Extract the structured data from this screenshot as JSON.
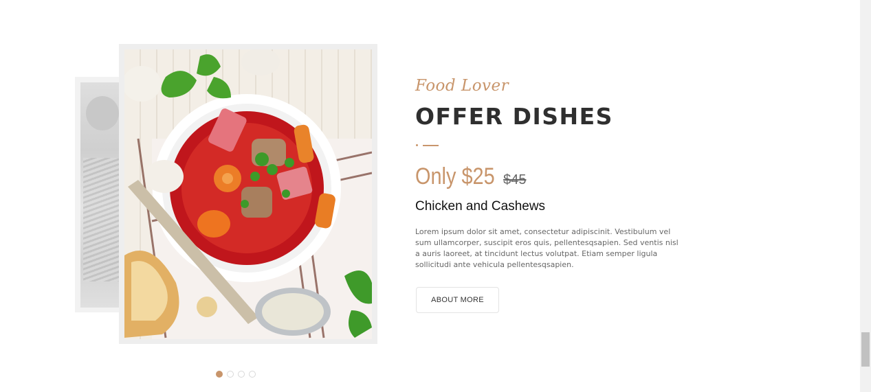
{
  "slide": {
    "tagline": "Food Lover",
    "title": "OFFER DISHES",
    "price": "Only $25",
    "old_price": "$45",
    "dish_name": "Chicken and Cashews",
    "description": "Lorem ipsum dolor sit amet, consectetur adipiscinit. Vestibulum vel sum ullamcorper, suscipit eros quis, pellentesqsapien. Sed ventis nisl a auris laoreet, at tincidunt lectus volutpat. Etiam semper ligula sollicitudi ante vehicula pellentesqsapien.",
    "button_label": "ABOUT MORE"
  },
  "pager": {
    "count": 4,
    "active_index": 0
  },
  "colors": {
    "accent": "#c8956b",
    "title": "#2f2f2f",
    "text": "#666666"
  }
}
